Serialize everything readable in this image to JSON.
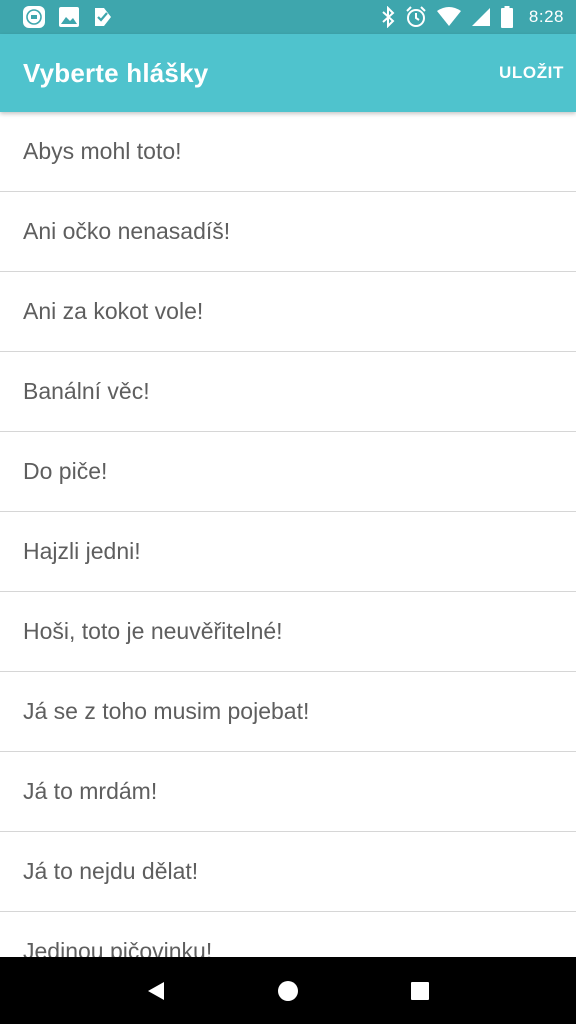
{
  "status_bar": {
    "time": "8:28",
    "left_icons": [
      "app-notification-icon",
      "image-icon",
      "check-notification-icon"
    ],
    "right_icons": [
      "bluetooth-icon",
      "alarm-icon",
      "wifi-icon",
      "signal-icon",
      "battery-icon"
    ],
    "background": "#3ea6ad"
  },
  "app_bar": {
    "title": "Vyberte hlášky",
    "save_label": "ULOŽIT",
    "background": "#4fc3cd"
  },
  "list": {
    "items": [
      "Abys mohl toto!",
      "Ani očko nenasadíš!",
      "Ani za kokot vole!",
      "Banální věc!",
      "Do piče!",
      "Hajzli jedni!",
      "Hoši, toto je neuvěřitelné!",
      "Já se z toho musim pojebat!",
      "Já to mrdám!",
      "Já to nejdu dělat!",
      "Jedinou pičovinku!"
    ]
  },
  "nav_bar": {
    "buttons": [
      "back-icon",
      "home-icon",
      "recents-icon"
    ]
  }
}
